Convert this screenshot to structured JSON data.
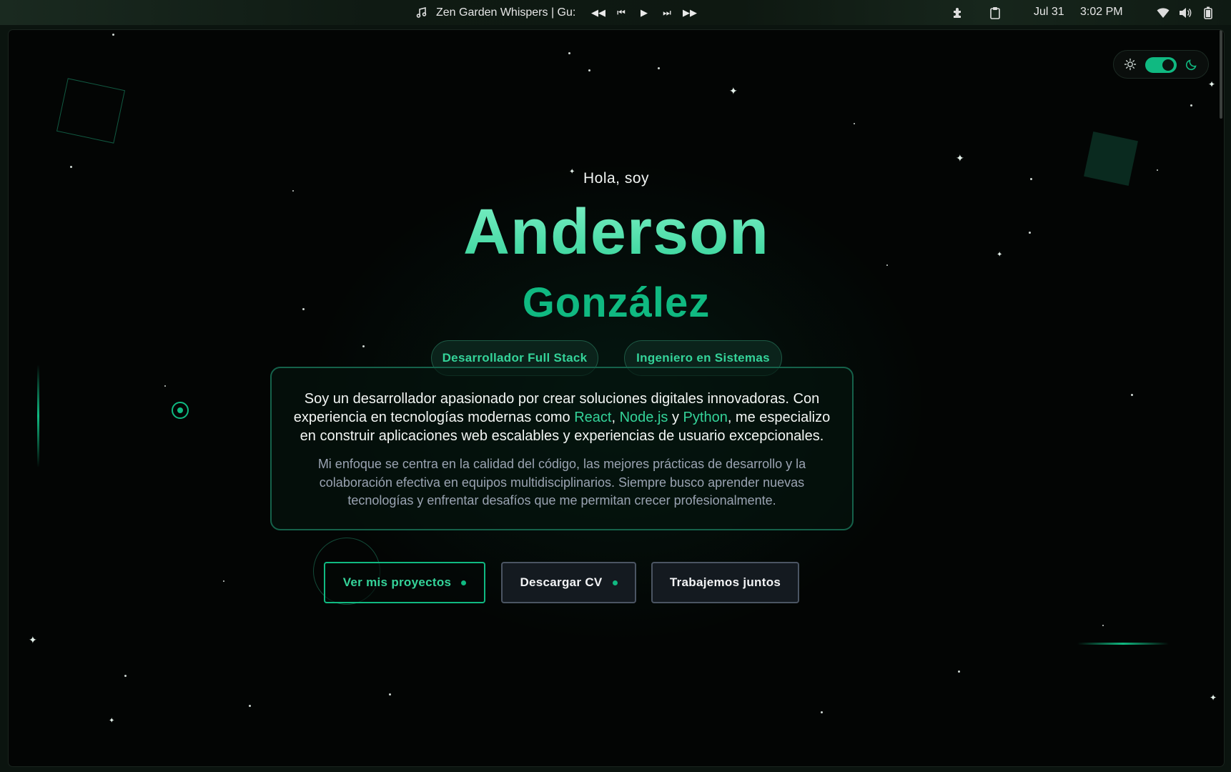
{
  "topbar": {
    "media_title": "Zen Garden Whispers | Gu:",
    "date": "Jul 31",
    "time": "3:02 PM"
  },
  "hero": {
    "greeting": "Hola, soy",
    "first_name": "Anderson",
    "last_name": "González",
    "roles": [
      "Desarrollador Full Stack",
      "Ingeniero en Sistemas"
    ]
  },
  "about": {
    "p1_start": "Soy un desarrollador apasionado por crear soluciones digitales innovadoras. Con experiencia en tecnologías modernas como ",
    "tech_1": "React",
    "sep_1": ", ",
    "tech_2": "Node.js",
    "sep_2": " y ",
    "tech_3": "Python",
    "p1_end": ", me especializo en construir aplicaciones web escalables y experiencias de usuario excepcionales.",
    "p2": "Mi enfoque se centra en la calidad del código, las mejores prácticas de desarrollo y la colaboración efectiva en equipos multidisciplinarios. Siempre busco aprender nuevas tecnologías y enfrentar desafíos que me permitan crecer profesionalmente."
  },
  "actions": {
    "projects_label": "Ver mis proyectos",
    "cv_label": "Descargar CV",
    "together_label": "Trabajemos juntos"
  },
  "theme": {
    "mode": "dark",
    "accent": "#10b981"
  },
  "colors": {
    "accent": "#10b981",
    "accent_light": "#34d399",
    "background": "#030504"
  }
}
